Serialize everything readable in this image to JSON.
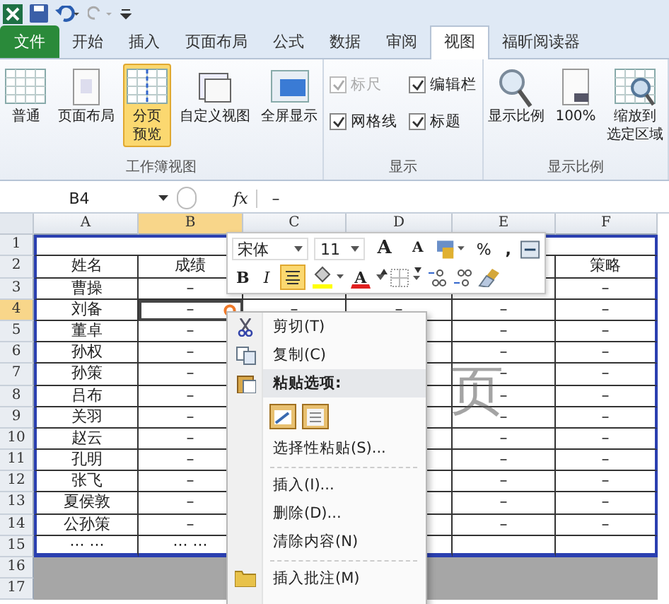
{
  "ribbon_tabs": [
    {
      "label": "文件",
      "kind": "file",
      "selected": false
    },
    {
      "label": "开始",
      "kind": "tab",
      "selected": false
    },
    {
      "label": "插入",
      "kind": "tab",
      "selected": false
    },
    {
      "label": "页面布局",
      "kind": "tab",
      "selected": false
    },
    {
      "label": "公式",
      "kind": "tab",
      "selected": false
    },
    {
      "label": "数据",
      "kind": "tab",
      "selected": false
    },
    {
      "label": "审阅",
      "kind": "tab",
      "selected": false
    },
    {
      "label": "视图",
      "kind": "tab",
      "selected": true
    },
    {
      "label": "福昕阅读器",
      "kind": "tab",
      "selected": false
    }
  ],
  "ribbon_groups": [
    {
      "label": "工作簿视图",
      "kind": "buttons",
      "buttons": [
        {
          "label": "普通",
          "kind": "grid",
          "selected": false
        },
        {
          "label": "页面布局",
          "kind": "page",
          "selected": false
        },
        {
          "lines": [
            "分页",
            "预览"
          ],
          "kind": "break",
          "selected": true
        },
        {
          "label": "自定义视图",
          "kind": "windows",
          "selected": false
        },
        {
          "label": "全屏显示",
          "kind": "screen",
          "selected": false
        }
      ]
    },
    {
      "label": "显示",
      "kind": "checks",
      "checks": [
        {
          "label": "标尺",
          "checked": true,
          "disabled": true
        },
        {
          "label": "编辑栏",
          "checked": true,
          "disabled": false
        },
        {
          "label": "网格线",
          "checked": true,
          "disabled": false
        },
        {
          "label": "标题",
          "checked": true,
          "disabled": false
        }
      ]
    },
    {
      "label": "显示比例",
      "kind": "buttons",
      "buttons": [
        {
          "label": "显示比例",
          "kind": "magnifier",
          "selected": false
        },
        {
          "label": "100%",
          "kind": "page100",
          "selected": false
        },
        {
          "lines": [
            "缩放到",
            "选定区域"
          ],
          "kind": "zoomsel",
          "selected": false
        }
      ]
    }
  ],
  "formula_bar": {
    "name_box": "B4",
    "fx": "fx",
    "formula": "–"
  },
  "sheet": {
    "columns": [
      {
        "label": "A",
        "selected": false
      },
      {
        "label": "B",
        "selected": true
      },
      {
        "label": "C",
        "selected": false
      },
      {
        "label": "D",
        "selected": false
      },
      {
        "label": "E",
        "selected": false
      },
      {
        "label": "F",
        "selected": false
      }
    ],
    "rows": [
      {
        "label": "1",
        "selected": false,
        "merged": true
      },
      {
        "label": "2",
        "selected": false,
        "cells": [
          "姓名",
          "成绩",
          null,
          null,
          null,
          "策略"
        ]
      },
      {
        "label": "3",
        "selected": false,
        "cells": [
          "曹操",
          "–",
          null,
          null,
          null,
          "–"
        ]
      },
      {
        "label": "4",
        "selected": true,
        "cells": [
          "刘备",
          "–",
          "–",
          "–",
          "–",
          "–"
        ]
      },
      {
        "label": "5",
        "selected": false,
        "cells": [
          "董卓",
          "–",
          null,
          null,
          "–",
          "–"
        ]
      },
      {
        "label": "6",
        "selected": false,
        "cells": [
          "孙权",
          "–",
          null,
          null,
          "–",
          "–"
        ]
      },
      {
        "label": "7",
        "selected": false,
        "cells": [
          "孙策",
          "–",
          null,
          null,
          "–",
          "–"
        ]
      },
      {
        "label": "8",
        "selected": false,
        "cells": [
          "吕布",
          "–",
          null,
          null,
          "–",
          "–"
        ]
      },
      {
        "label": "9",
        "selected": false,
        "cells": [
          "关羽",
          "–",
          null,
          null,
          "–",
          "–"
        ]
      },
      {
        "label": "10",
        "selected": false,
        "cells": [
          "赵云",
          "–",
          null,
          null,
          "–",
          "–"
        ]
      },
      {
        "label": "11",
        "selected": false,
        "cells": [
          "孔明",
          "–",
          null,
          null,
          "–",
          "–"
        ]
      },
      {
        "label": "12",
        "selected": false,
        "cells": [
          "张飞",
          "–",
          null,
          null,
          "–",
          "–"
        ]
      },
      {
        "label": "13",
        "selected": false,
        "cells": [
          "夏侯敦",
          "–",
          null,
          null,
          "–",
          "–"
        ]
      },
      {
        "label": "14",
        "selected": false,
        "cells": [
          "公孙策",
          "–",
          null,
          null,
          "–",
          "–"
        ]
      },
      {
        "label": "15",
        "selected": false,
        "cells": [
          "··· ···",
          "··· ···",
          null,
          null,
          null,
          null
        ]
      }
    ],
    "outside_rows": [
      "16",
      "17"
    ],
    "page_label": "页"
  },
  "mini_toolbar": {
    "font": "宋体",
    "size": "11",
    "grow_font": "A",
    "shrink_font": "A",
    "percent": "%",
    "comma": ",",
    "bold": "B",
    "italic": "I",
    "center_selected": true,
    "font_color": "A"
  },
  "context_menu": [
    {
      "label": "剪切(T)",
      "kind": "cut"
    },
    {
      "label": "复制(C)",
      "kind": "copy"
    },
    {
      "label": "粘贴选项:",
      "kind": "header"
    },
    {
      "kind": "paste-icons"
    },
    {
      "label": "选择性粘贴(S)...",
      "kind": "command"
    },
    {
      "kind": "separator"
    },
    {
      "label": "插入(I)...",
      "kind": "command"
    },
    {
      "label": "删除(D)...",
      "kind": "command"
    },
    {
      "label": "清除内容(N)",
      "kind": "command"
    },
    {
      "kind": "separator"
    },
    {
      "label": "插入批注(M)",
      "kind": "comment"
    }
  ]
}
